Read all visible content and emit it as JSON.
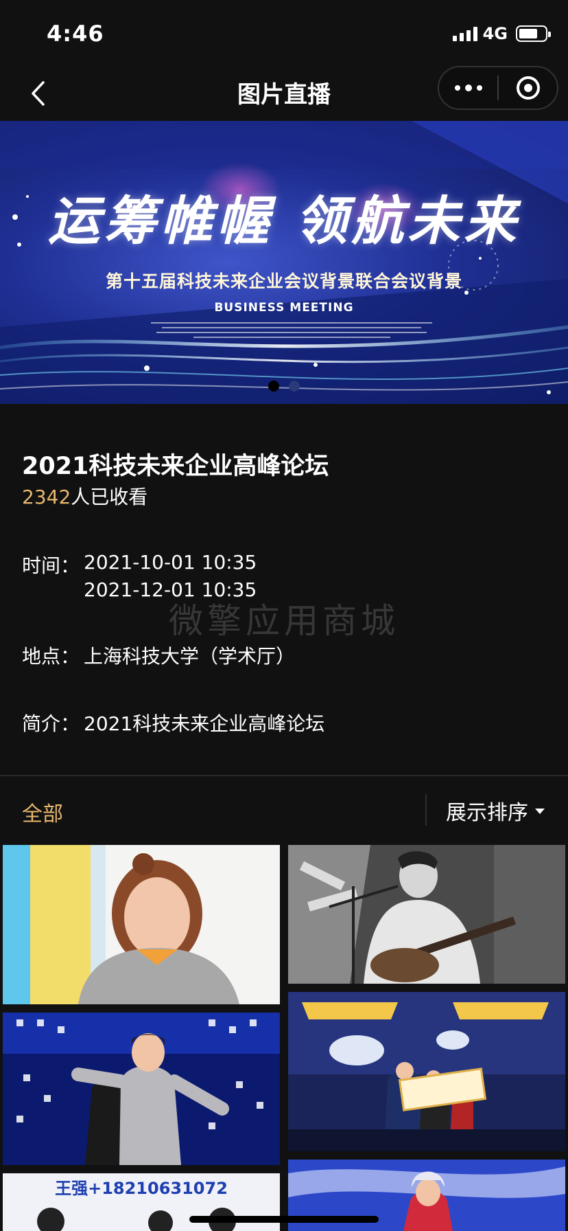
{
  "status_bar": {
    "time": "4:46",
    "network": "4G"
  },
  "nav": {
    "title": "图片直播"
  },
  "banner": {
    "headline": "运筹帷幄 领航未来",
    "subtitle": "第十五届科技未来企业会议背景联合会议背景",
    "english": "BUSINESS MEETING",
    "page_count": 2,
    "active_index": 0
  },
  "event": {
    "title": "2021科技未来企业高峰论坛",
    "views_count": "2342",
    "views_suffix": "人已收看",
    "time_label": "时间：",
    "time_start": "2021-10-01 10:35",
    "time_end": "2021-12-01 10:35",
    "place_label": "地点：",
    "place": "上海科技大学（学术厅）",
    "intro_label": "简介：",
    "intro": "2021科技未来企业高峰论坛"
  },
  "watermark": "微擎应用商城",
  "filter": {
    "all_tab": "全部",
    "sort_label": "展示排序"
  },
  "photos": [
    {
      "caption": ""
    },
    {
      "caption": ""
    },
    {
      "caption": ""
    },
    {
      "caption": ""
    },
    {
      "caption": "王强+18210631072"
    },
    {
      "caption": ""
    }
  ],
  "colors": {
    "accent": "#e8b86d",
    "background": "#111111",
    "banner_blue": "#1f2f94"
  }
}
